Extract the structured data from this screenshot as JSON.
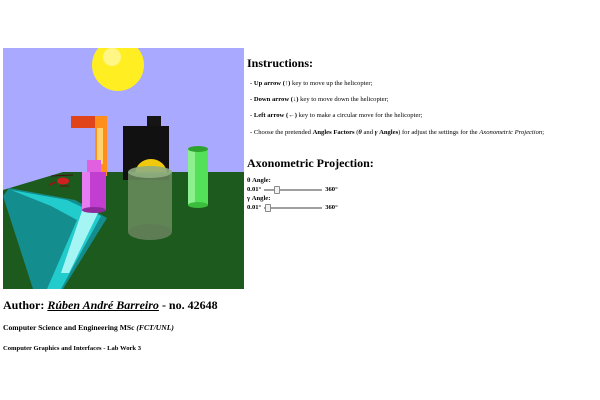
{
  "instructions": {
    "title": "Instructions:",
    "items": [
      {
        "prefix": "- ",
        "key": "Up arrow",
        "glyph": "(↑)",
        "rest": " key to move up the helicopter;"
      },
      {
        "prefix": "- ",
        "key": "Down arrow",
        "glyph": "(↓)",
        "rest": " key to move down the helicopter;"
      },
      {
        "prefix": "- ",
        "key": "Left arrow",
        "glyph": "(←)",
        "rest": " key to make a circular move for the helicopter;"
      }
    ],
    "last": {
      "pre": "- Choose the pretended ",
      "bold": "Angles Factors",
      "mid1": " (",
      "theta": "θ",
      "and": " and ",
      "gamma": "γ",
      "angles": " Angles",
      "post": ") for adjust the settings for the ",
      "italic": "Axonometric Projection",
      "end": ";"
    }
  },
  "axonometric": {
    "title": "Axonometric Projection:",
    "theta": {
      "label": "θ Angle:",
      "min_label": "0.01°",
      "max_label": "360°",
      "value_fraction": 0.2
    },
    "gamma": {
      "label": "γ Angle:",
      "min_label": "0.01°",
      "max_label": "360°",
      "value_fraction": 0.02
    }
  },
  "footer": {
    "author_prefix": "Author: ",
    "author_name": "Rúben André Barreiro",
    "author_suffix": " - no. 42648",
    "degree": "Computer Science and Engineering MSc ",
    "degree_italic": "(FCT/UNL)",
    "course": "Computer Graphics and Interfaces - Lab Work 3"
  },
  "scene_colors": {
    "sky": "#a9a9ff",
    "ground": "#1d5a1d",
    "sun": "#ffee22",
    "road": "#1fbfbf"
  }
}
